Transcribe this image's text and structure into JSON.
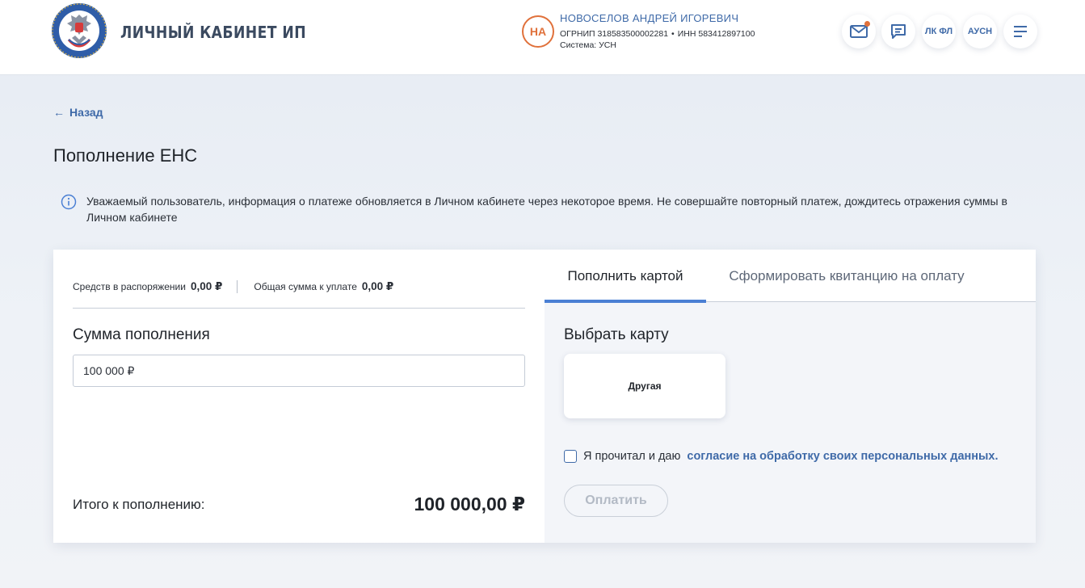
{
  "header": {
    "app_title": "ЛИЧНЫЙ КАБИНЕТ ИП",
    "user": {
      "initials": "НА",
      "name": "НОВОСЕЛОВ АНДРЕЙ ИГОРЕВИЧ",
      "ogrnip": "ОГРНИП 318583500002281",
      "inn": "ИНН 583412897100",
      "system": "Система: УСН",
      "separator": "•"
    },
    "buttons": {
      "lk_fl": "ЛК ФЛ",
      "ausn": "АУСН"
    },
    "colors": {
      "accent": "#3f6aa8",
      "avatar": "#e0713b"
    }
  },
  "nav": {
    "back_label": "Назад",
    "back_arrow": "←"
  },
  "page": {
    "title": "Пополнение ЕНС",
    "info": "Уважаемый пользователь, информация о платеже обновляется в Личном кабинете через некоторое время. Не совершайте повторный платеж, дождитесь отражения суммы в Личном кабинете"
  },
  "left": {
    "available_label": "Средств в распоряжении",
    "available_value": "0,00 ₽",
    "due_label": "Общая сумма к уплате",
    "due_value": "0,00 ₽",
    "amount_label": "Сумма пополнения",
    "amount_value": "100 000 ₽",
    "total_label": "Итого к пополнению:",
    "total_value": "100 000,00 ₽"
  },
  "right": {
    "tabs": [
      {
        "label": "Пополнить картой",
        "active": true
      },
      {
        "label": "Сформировать квитанцию на оплату",
        "active": false
      }
    ],
    "choose_label": "Выбрать карту",
    "card_option": "Другая",
    "consent_prefix": "Я прочитал и даю",
    "consent_link": "согласие на обработку своих персональных данных.",
    "pay_label": "Оплатить"
  }
}
